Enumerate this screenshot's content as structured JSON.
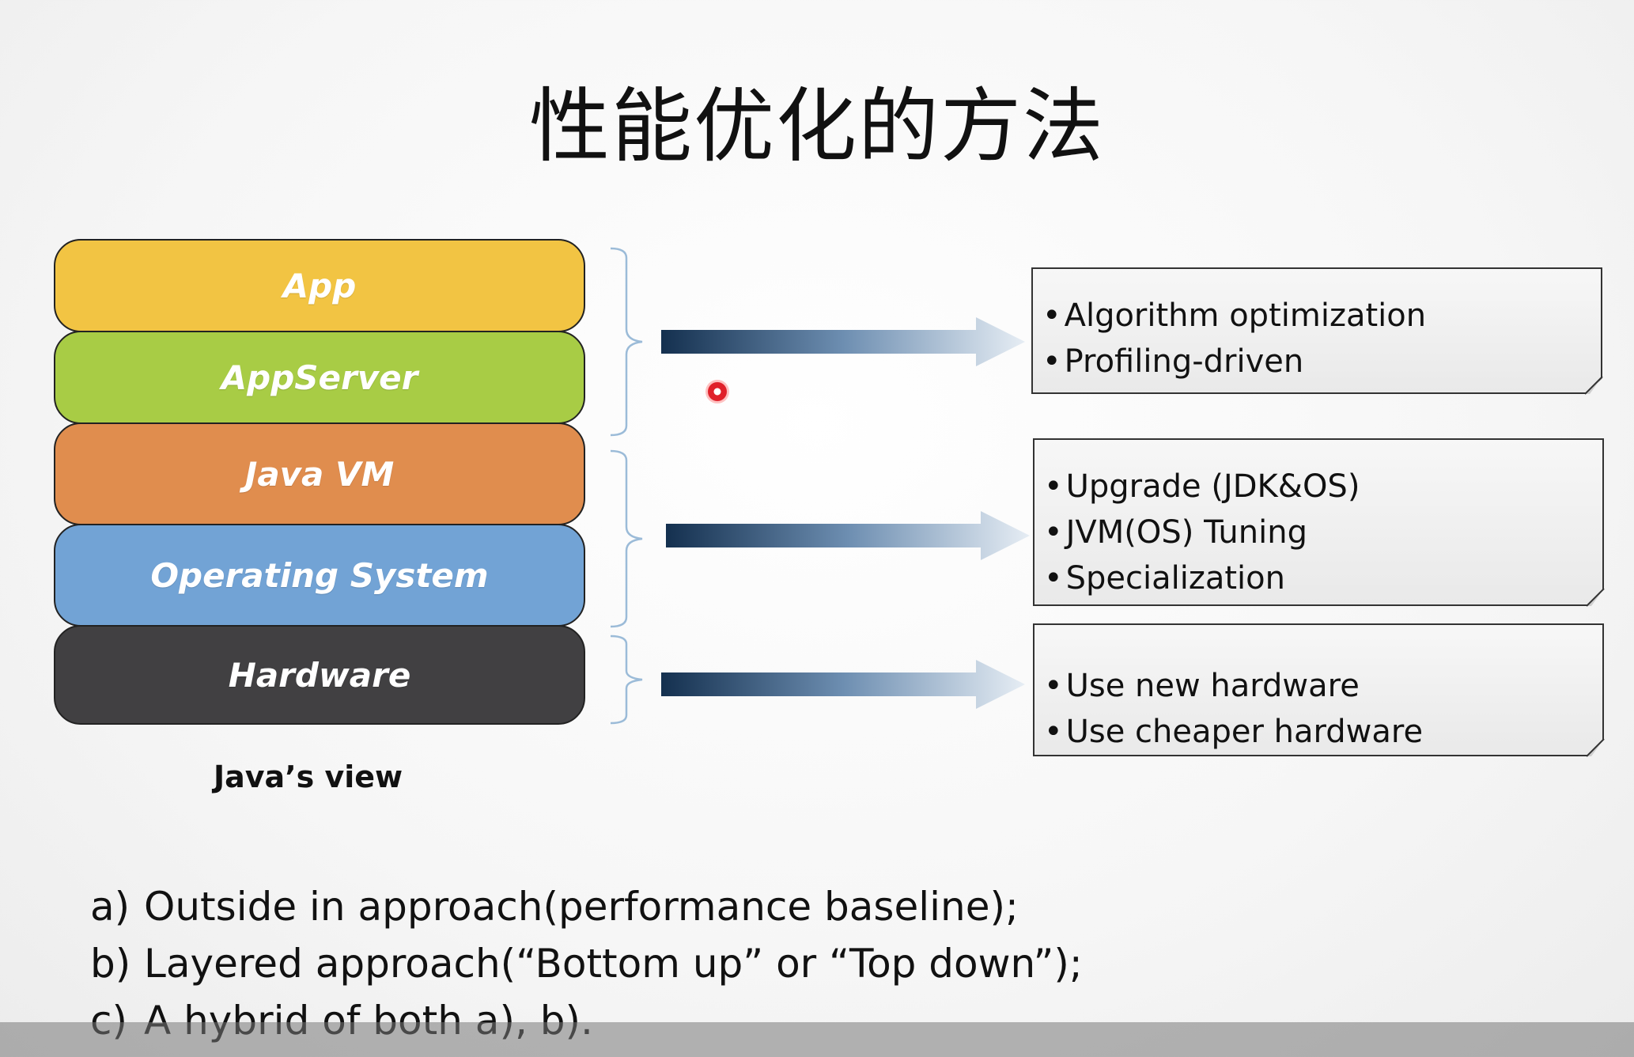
{
  "title": "性能优化的方法",
  "stack": {
    "layers": [
      {
        "label": "App",
        "color": "#f2c443"
      },
      {
        "label": "AppServer",
        "color": "#a8cc45"
      },
      {
        "label": "Java VM",
        "color": "#e08d4e"
      },
      {
        "label": "Operating System",
        "color": "#72a3d5"
      },
      {
        "label": "Hardware",
        "color": "#414042"
      }
    ],
    "caption": "Java’s view"
  },
  "notes": [
    {
      "items": [
        "Algorithm optimization",
        "Profiling-driven"
      ]
    },
    {
      "items": [
        "Upgrade (JDK&OS)",
        "JVM(OS) Tuning",
        "Specialization"
      ]
    },
    {
      "items": [
        "Use new hardware",
        "Use cheaper hardware"
      ]
    }
  ],
  "approaches": [
    {
      "marker": "a)",
      "text": "Outside in approach(performance baseline);"
    },
    {
      "marker": "b)",
      "text": "Layered approach(“Bottom up” or “Top down”);"
    },
    {
      "marker": "c)",
      "text": "A hybrid of both a), b)."
    }
  ],
  "colors": {
    "arrow_dark": "#14304f",
    "arrow_light": "#dce6f0",
    "brace": "#9bbbd8",
    "pointer": "#e0202a"
  }
}
